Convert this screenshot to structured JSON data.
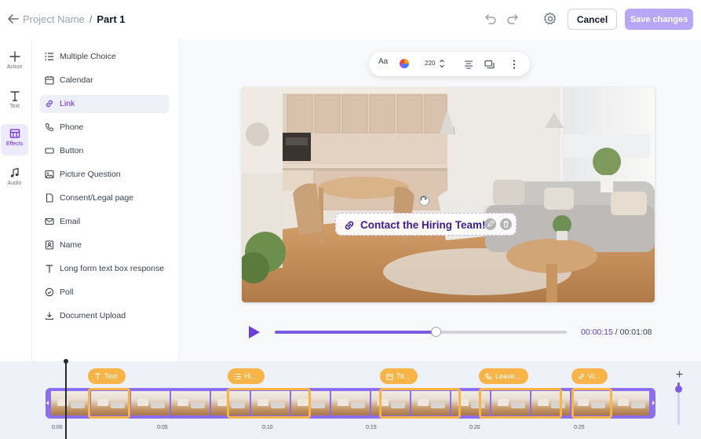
{
  "header": {
    "project_name": "Project Name",
    "separator": "/",
    "part": "Part 1",
    "cancel_label": "Cancel",
    "save_label": "Save changes"
  },
  "rail": {
    "items": [
      {
        "label": "Action",
        "icon": "plus-icon"
      },
      {
        "label": "Text",
        "icon": "text-icon"
      },
      {
        "label": "Effects",
        "icon": "effects-icon",
        "active": true
      },
      {
        "label": "Audio",
        "icon": "music-note-icon"
      }
    ]
  },
  "panel": {
    "items": [
      {
        "label": "Multiple Choice",
        "icon": "list-icon"
      },
      {
        "label": "Calendar",
        "icon": "calendar-icon"
      },
      {
        "label": "Link",
        "icon": "link-icon",
        "active": true
      },
      {
        "label": "Phone",
        "icon": "phone-icon"
      },
      {
        "label": "Button",
        "icon": "button-icon"
      },
      {
        "label": "Picture Question",
        "icon": "image-icon"
      },
      {
        "label": "Consent/Legal page",
        "icon": "document-icon"
      },
      {
        "label": "Email",
        "icon": "mail-icon"
      },
      {
        "label": "Name",
        "icon": "id-card-icon"
      },
      {
        "label": "Long form text box response",
        "icon": "text-icon"
      },
      {
        "label": "Poll",
        "icon": "poll-icon"
      },
      {
        "label": "Document Upload",
        "icon": "download-icon"
      }
    ]
  },
  "toolbar": {
    "font_label": "Aa",
    "size_value": "220"
  },
  "overlay": {
    "cta_text": "Contact the Hiring Team!"
  },
  "player": {
    "current_time": "00:00:15",
    "separator": " / ",
    "total_time": "00:01:08",
    "progress": 0.55
  },
  "timeline": {
    "chips": [
      {
        "label": "Text",
        "icon": "text-icon"
      },
      {
        "label": "Hi...",
        "icon": "list-icon"
      },
      {
        "label": "Tit...",
        "icon": "calendar-icon"
      },
      {
        "label": "Leave...",
        "icon": "phone-icon"
      },
      {
        "label": "Vi...",
        "icon": "link-icon"
      }
    ],
    "ticks": [
      "0:00",
      "0:05",
      "0:10",
      "0:15",
      "0:20",
      "0:25"
    ],
    "zoom_level": 0.15
  },
  "colors": {
    "accent": "#7c5ce6",
    "accent_light": "#b8a6f7",
    "highlight": "#f8b447"
  }
}
